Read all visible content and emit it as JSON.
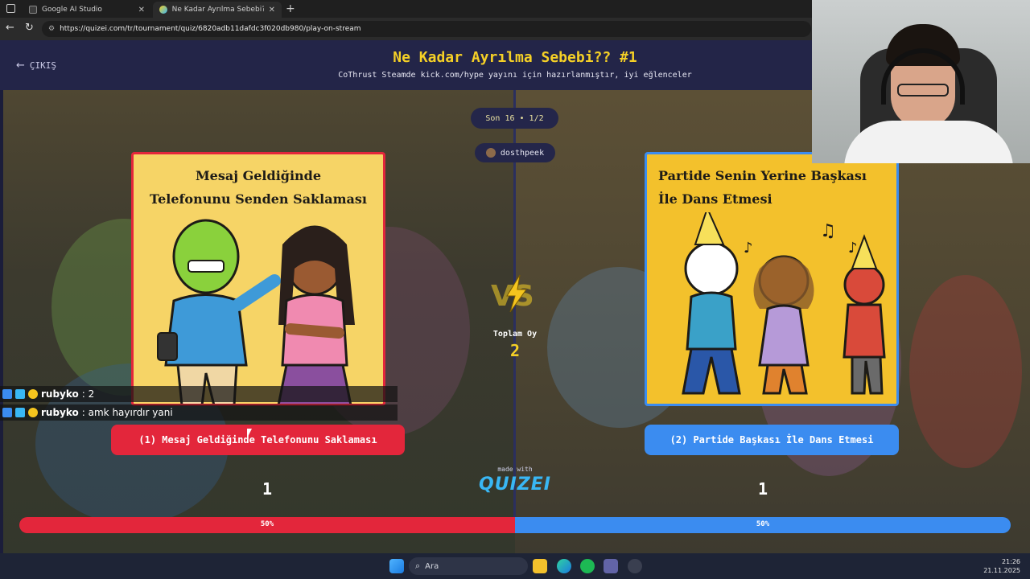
{
  "browser": {
    "tabs": [
      {
        "label": "Google AI Studio"
      },
      {
        "label": "Ne Kadar Ayrılma Sebebi?? #1 - Tur..."
      }
    ],
    "url": "https://quizei.com/tr/tournament/quiz/6820adb11dafdc3f020db980/play-on-stream"
  },
  "page": {
    "exit_label": "ÇIKIŞ",
    "title": "Ne Kadar Ayrılma Sebebi?? #1",
    "subtitle": "CoThrust Steamde kick.com/hype yayını için hazırlanmıştır, iyi eğlenceler",
    "round": "Son 16 • 1/2",
    "streamer": "dosthpeek",
    "total_label": "Toplam Oy",
    "total_votes": "2",
    "made_with": "made with",
    "brand": "QUIZEI"
  },
  "left": {
    "card_title_1": "Mesaj Geldiğinde",
    "card_title_2": "Telefonunu Senden Saklaması",
    "choice_label": "(1) Mesaj Geldiğinde Telefonunu Saklaması",
    "votes": "1",
    "percent_label": "50%",
    "percent": 50,
    "color": "#e3263b"
  },
  "right": {
    "card_title_1": "Partide Senin Yerine Başkası",
    "card_title_2": "İle Dans Etmesi",
    "choice_label": "(2) Partide Başkası İle Dans Etmesi",
    "votes": "1",
    "percent_label": "50%",
    "percent": 50,
    "color": "#3b8cf0"
  },
  "chat": [
    {
      "user": "rubyko",
      "message": ": 2"
    },
    {
      "user": "rubyko",
      "message": ": amk hayırdır yani"
    }
  ],
  "taskbar": {
    "search_placeholder": "Ara",
    "time": "21:26",
    "date": "21.11.2025"
  }
}
